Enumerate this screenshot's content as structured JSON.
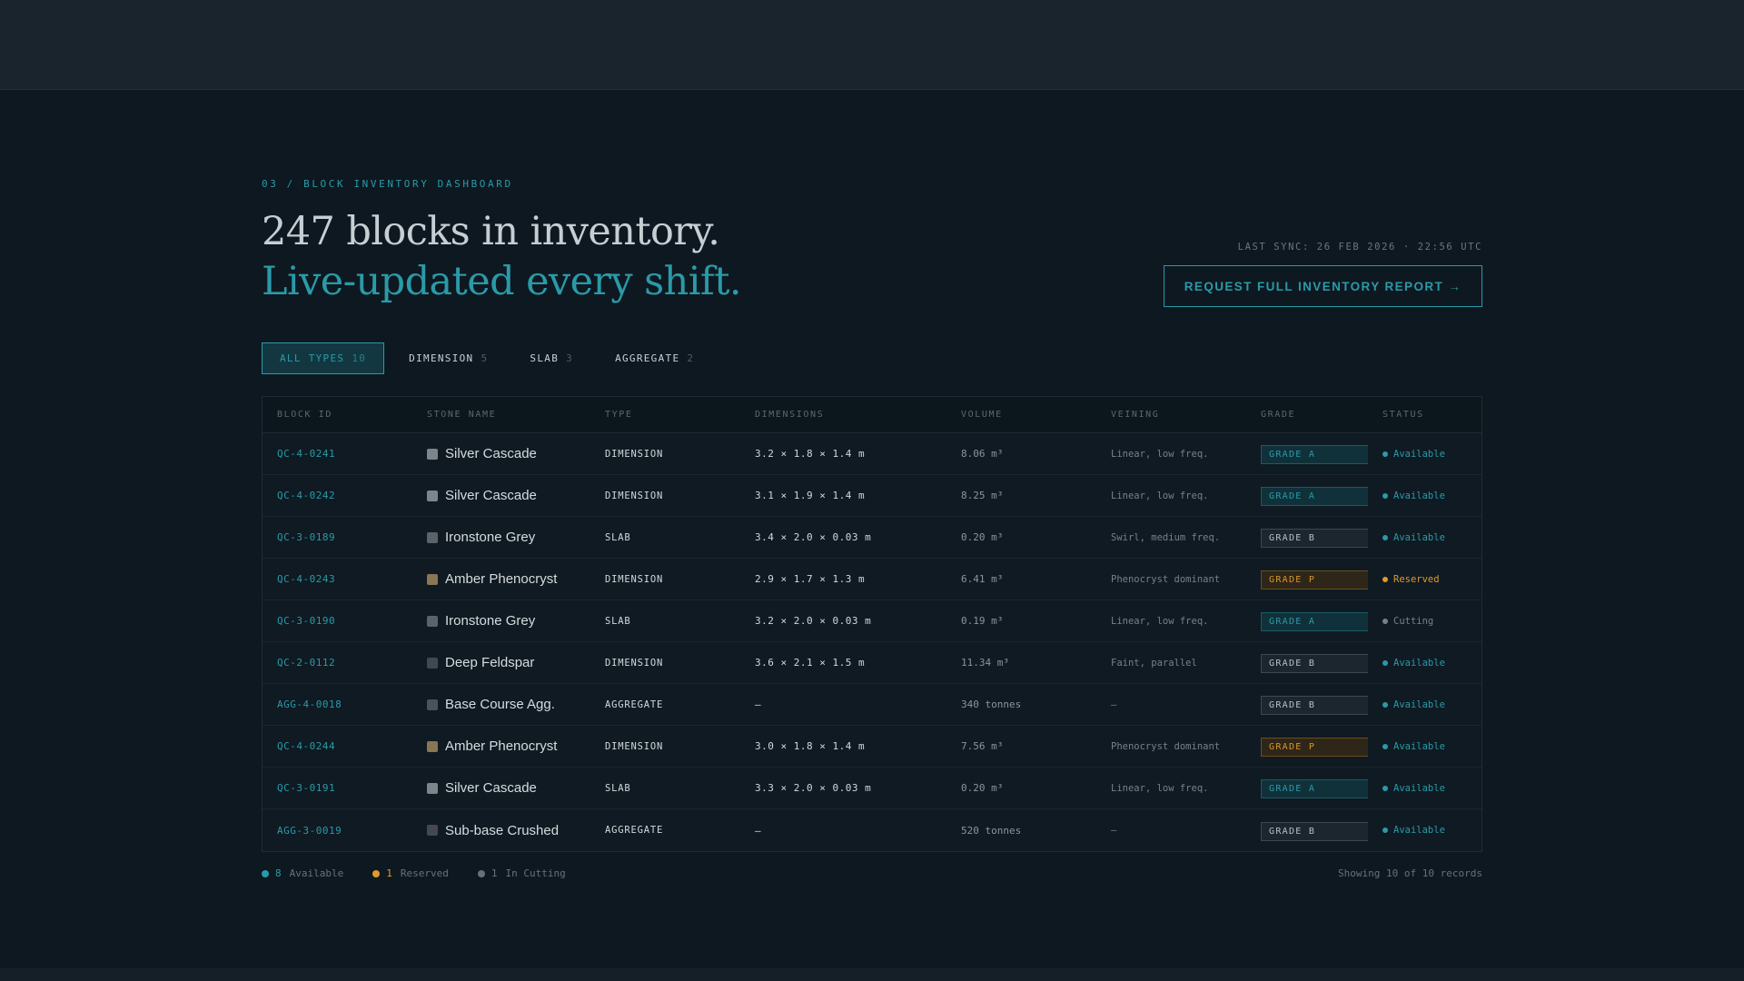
{
  "header": {
    "eyebrow": "03 / BLOCK INVENTORY DASHBOARD",
    "headline_line1": "247 blocks in inventory.",
    "headline_line2": "Live-updated every shift.",
    "last_sync": "LAST SYNC: 26 FEB 2026 · 22:56 UTC",
    "report_button": "REQUEST FULL INVENTORY REPORT →"
  },
  "tabs": [
    {
      "label": "ALL TYPES",
      "count": "10",
      "active": true
    },
    {
      "label": "DIMENSION",
      "count": "5",
      "active": false
    },
    {
      "label": "SLAB",
      "count": "3",
      "active": false
    },
    {
      "label": "AGGREGATE",
      "count": "2",
      "active": false
    }
  ],
  "table": {
    "columns": [
      "BLOCK ID",
      "STONE NAME",
      "TYPE",
      "DIMENSIONS",
      "VOLUME",
      "VEINING",
      "GRADE",
      "STATUS"
    ],
    "rows": [
      {
        "id": "QC-4-0241",
        "name": "Silver Cascade",
        "swatch": "#7d858b",
        "type": "DIMENSION",
        "dims": "3.2 × 1.8 × 1.4 m",
        "volume": "8.06 m³",
        "veining": "Linear, low freq.",
        "grade": "GRADE A",
        "grade_class": "a",
        "status": "Available",
        "status_class": "available"
      },
      {
        "id": "QC-4-0242",
        "name": "Silver Cascade",
        "swatch": "#7d858b",
        "type": "DIMENSION",
        "dims": "3.1 × 1.9 × 1.4 m",
        "volume": "8.25 m³",
        "veining": "Linear, low freq.",
        "grade": "GRADE A",
        "grade_class": "a",
        "status": "Available",
        "status_class": "available"
      },
      {
        "id": "QC-3-0189",
        "name": "Ironstone Grey",
        "swatch": "#5b6369",
        "type": "SLAB",
        "dims": "3.4 × 2.0 × 0.03 m",
        "volume": "0.20 m³",
        "veining": "Swirl, medium freq.",
        "grade": "GRADE B",
        "grade_class": "b",
        "status": "Available",
        "status_class": "available"
      },
      {
        "id": "QC-4-0243",
        "name": "Amber Phenocryst",
        "swatch": "#8a7555",
        "type": "DIMENSION",
        "dims": "2.9 × 1.7 × 1.3 m",
        "volume": "6.41 m³",
        "veining": "Phenocryst dominant",
        "grade": "GRADE P",
        "grade_class": "p",
        "status": "Reserved",
        "status_class": "reserved"
      },
      {
        "id": "QC-3-0190",
        "name": "Ironstone Grey",
        "swatch": "#5b6369",
        "type": "SLAB",
        "dims": "3.2 × 2.0 × 0.03 m",
        "volume": "0.19 m³",
        "veining": "Linear, low freq.",
        "grade": "GRADE A",
        "grade_class": "a",
        "status": "Cutting",
        "status_class": "cutting"
      },
      {
        "id": "QC-2-0112",
        "name": "Deep Feldspar",
        "swatch": "#3f4950",
        "type": "DIMENSION",
        "dims": "3.6 × 2.1 × 1.5 m",
        "volume": "11.34 m³",
        "veining": "Faint, parallel",
        "grade": "GRADE B",
        "grade_class": "b",
        "status": "Available",
        "status_class": "available"
      },
      {
        "id": "AGG-4-0018",
        "name": "Base Course Agg.",
        "swatch": "#4c5358",
        "type": "AGGREGATE",
        "dims": "—",
        "volume": "340 tonnes",
        "veining": "—",
        "grade": "GRADE B",
        "grade_class": "b",
        "status": "Available",
        "status_class": "available"
      },
      {
        "id": "QC-4-0244",
        "name": "Amber Phenocryst",
        "swatch": "#8a7555",
        "type": "DIMENSION",
        "dims": "3.0 × 1.8 × 1.4 m",
        "volume": "7.56 m³",
        "veining": "Phenocryst dominant",
        "grade": "GRADE P",
        "grade_class": "p",
        "status": "Available",
        "status_class": "available"
      },
      {
        "id": "QC-3-0191",
        "name": "Silver Cascade",
        "swatch": "#7d858b",
        "type": "SLAB",
        "dims": "3.3 × 2.0 × 0.03 m",
        "volume": "0.20 m³",
        "veining": "Linear, low freq.",
        "grade": "GRADE A",
        "grade_class": "a",
        "status": "Available",
        "status_class": "available"
      },
      {
        "id": "AGG-3-0019",
        "name": "Sub-base Crushed",
        "swatch": "#45494d",
        "type": "AGGREGATE",
        "dims": "—",
        "volume": "520 tonnes",
        "veining": "—",
        "grade": "GRADE B",
        "grade_class": "b",
        "status": "Available",
        "status_class": "available"
      }
    ]
  },
  "legend": {
    "available_count": "8",
    "available_label": "Available",
    "reserved_count": "1",
    "reserved_label": "Reserved",
    "cutting_count": "1",
    "cutting_label": "In Cutting"
  },
  "records_text": "Showing 10 of 10 records",
  "colors": {
    "accent": "#2a9aa8",
    "reserved": "#e09a2c",
    "background": "#0e1820"
  }
}
